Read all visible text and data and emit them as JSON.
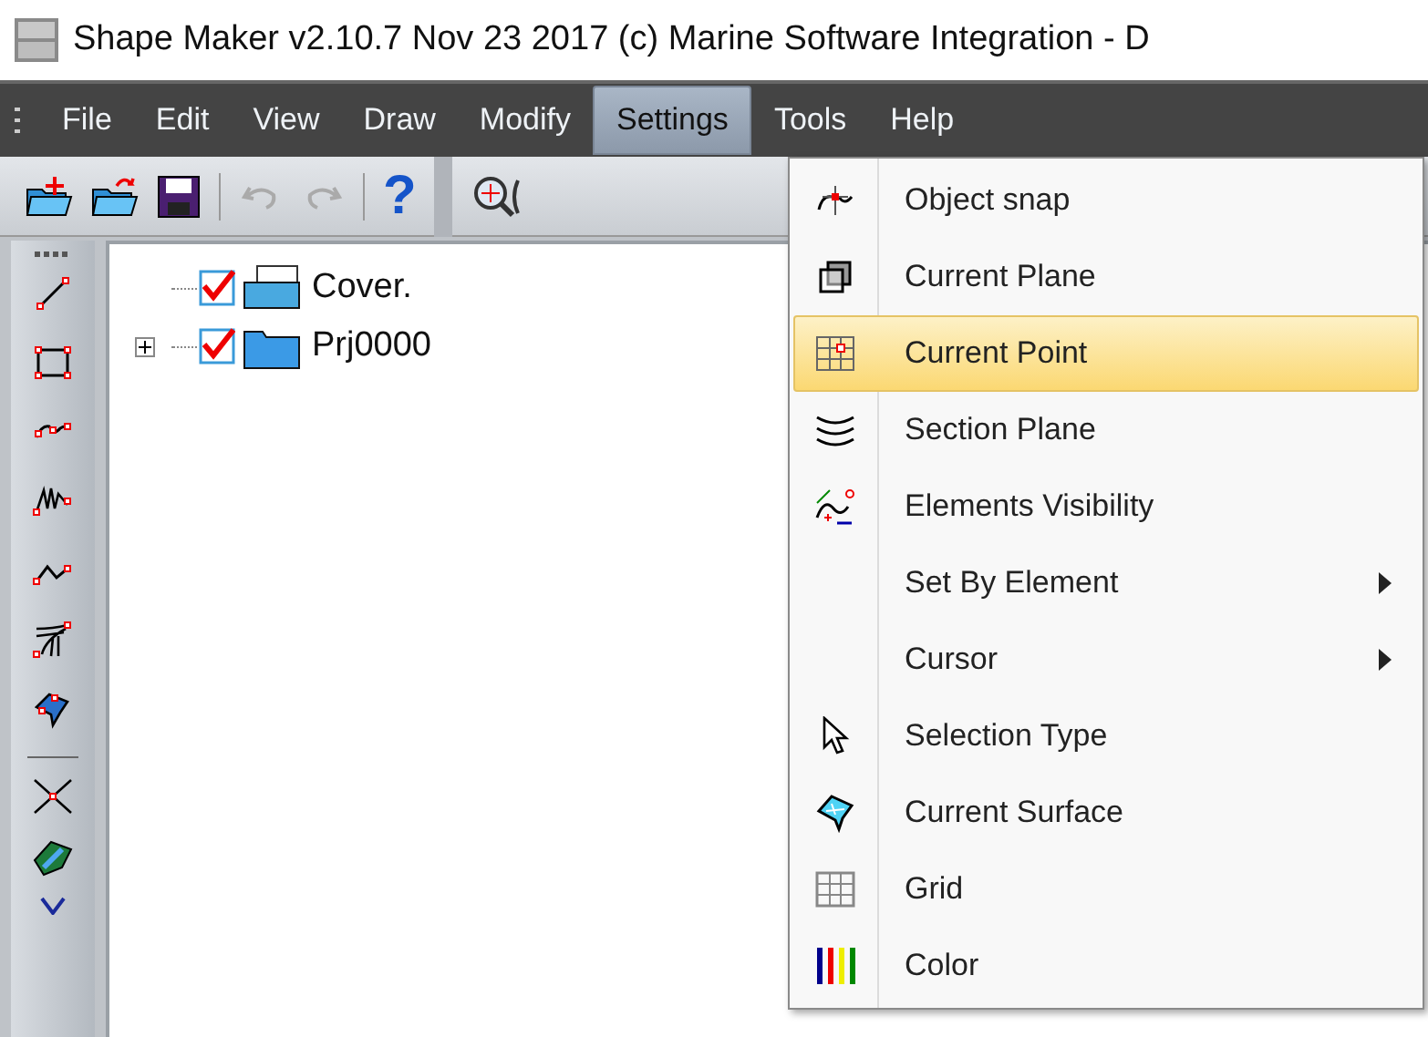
{
  "window": {
    "title": "Shape Maker v2.10.7 Nov 23 2017 (c) Marine Software Integration  - D"
  },
  "menu_bar": [
    {
      "label": "File",
      "selected": false
    },
    {
      "label": "Edit",
      "selected": false
    },
    {
      "label": "View",
      "selected": false
    },
    {
      "label": "Draw",
      "selected": false
    },
    {
      "label": "Modify",
      "selected": false
    },
    {
      "label": "Settings",
      "selected": true
    },
    {
      "label": "Tools",
      "selected": false
    },
    {
      "label": "Help",
      "selected": false
    }
  ],
  "toolbar": {
    "help_glyph": "?"
  },
  "tree": [
    {
      "label": "Cover.",
      "kind": "document",
      "checked": true
    },
    {
      "label": "Prj0000",
      "kind": "folder",
      "checked": true,
      "expanded": false
    }
  ],
  "settings_menu": [
    {
      "label": "Object snap",
      "selected": false,
      "submenu": false
    },
    {
      "label": "Current Plane",
      "selected": false,
      "submenu": false
    },
    {
      "label": "Current Point",
      "selected": true,
      "submenu": false
    },
    {
      "label": "Section Plane",
      "selected": false,
      "submenu": false
    },
    {
      "label": "Elements Visibility",
      "selected": false,
      "submenu": false
    },
    {
      "label": "Set By Element",
      "selected": false,
      "submenu": true
    },
    {
      "label": "Cursor",
      "selected": false,
      "submenu": true
    },
    {
      "label": "Selection Type",
      "selected": false,
      "submenu": false
    },
    {
      "label": "Current Surface",
      "selected": false,
      "submenu": false
    },
    {
      "label": "Grid",
      "selected": false,
      "submenu": false
    },
    {
      "label": "Color",
      "selected": false,
      "submenu": false
    }
  ]
}
